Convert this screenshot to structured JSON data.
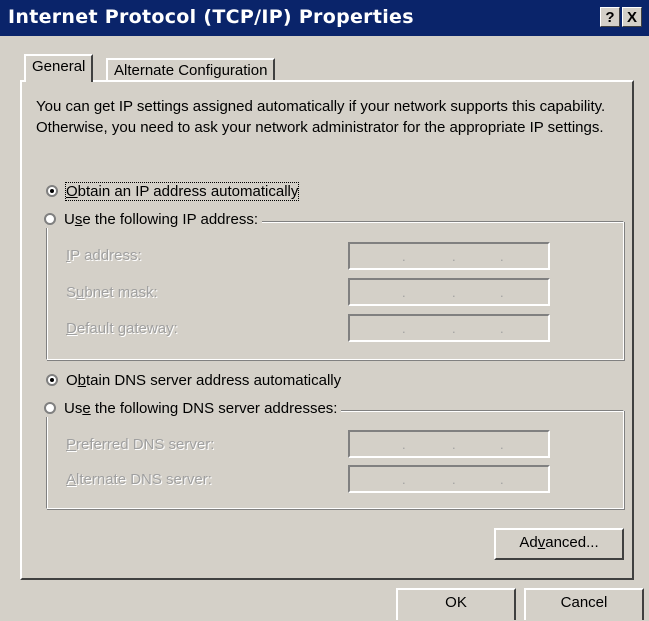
{
  "window": {
    "title": "Internet Protocol (TCP/IP) Properties",
    "help_label": "?",
    "close_label": "X"
  },
  "tabs": [
    {
      "label": "General",
      "selected": true
    },
    {
      "label": "Alternate Configuration",
      "selected": false
    }
  ],
  "description": "You can get IP settings assigned automatically if your network supports this capability. Otherwise, you need to ask your network administrator for the appropriate IP settings.",
  "ip_section": {
    "auto_option": {
      "pre": "",
      "key": "O",
      "post": "btain an IP address automatically",
      "checked": true
    },
    "manual_option": {
      "pre": "U",
      "key": "s",
      "post": "e the following IP address:",
      "checked": false
    },
    "fields": [
      {
        "key": "I",
        "rest": "P address:",
        "value": ""
      },
      {
        "pre": "S",
        "key": "u",
        "rest": "bnet mask:",
        "value": ""
      },
      {
        "key": "D",
        "rest": "efault gateway:",
        "value": ""
      }
    ]
  },
  "dns_section": {
    "auto_option": {
      "pre": "O",
      "key": "b",
      "post": "tain DNS server address automatically",
      "checked": true
    },
    "manual_option": {
      "pre": "Us",
      "key": "e",
      "post": " the following DNS server addresses:",
      "checked": false
    },
    "fields": [
      {
        "key": "P",
        "rest": "referred DNS server:",
        "value": ""
      },
      {
        "key": "A",
        "rest": "lternate DNS server:",
        "value": ""
      }
    ]
  },
  "buttons": {
    "advanced": {
      "pre": "Ad",
      "key": "v",
      "post": "anced..."
    },
    "ok": "OK",
    "cancel": "Cancel"
  },
  "ip_separator": "."
}
